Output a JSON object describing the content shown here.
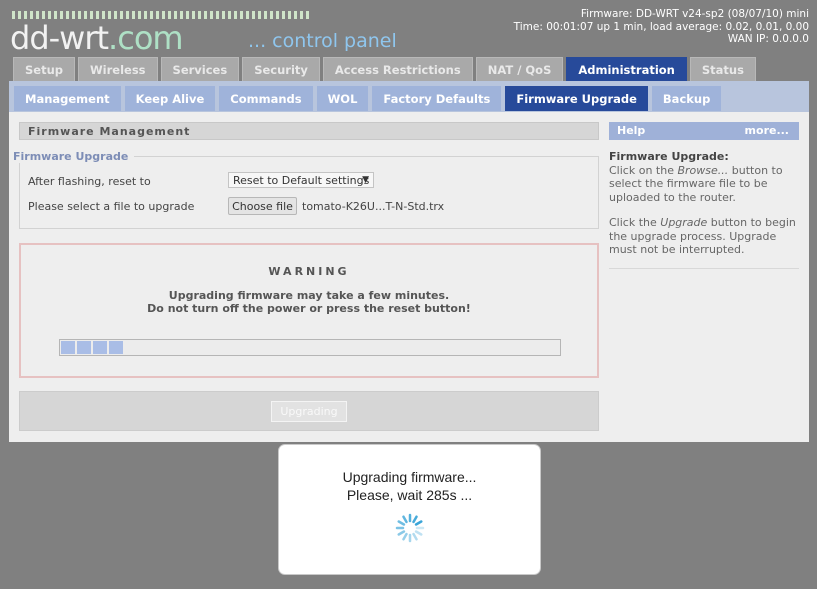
{
  "header": {
    "logo_main": "dd-wrt",
    "logo_domain": ".com",
    "tagline": "... control panel",
    "firmware": "Firmware: DD-WRT v24-sp2 (08/07/10) mini",
    "time": "Time: 00:01:07 up 1 min, load average: 0.02, 0.01, 0.00",
    "wan_ip": "WAN IP: 0.0.0.0"
  },
  "main_tabs": [
    "Setup",
    "Wireless",
    "Services",
    "Security",
    "Access Restrictions",
    "NAT / QoS",
    "Administration",
    "Status"
  ],
  "main_tab_active": "Administration",
  "sub_tabs": [
    "Management",
    "Keep Alive",
    "Commands",
    "WOL",
    "Factory Defaults",
    "Firmware Upgrade",
    "Backup"
  ],
  "sub_tab_active": "Firmware Upgrade",
  "section": {
    "title": "Firmware Management",
    "legend": "Firmware Upgrade",
    "reset_label": "After flashing, reset to",
    "reset_value": "Reset to Default settings",
    "file_label": "Please select a file to upgrade",
    "file_button": "Choose file",
    "file_name": "tomato-K26U...T-N-Std.trx"
  },
  "warning": {
    "title": "WARNING",
    "line1": "Upgrading firmware may take a few minutes.",
    "line2": "Do not turn off the power or press the reset button!",
    "progress_segments": 4
  },
  "upgrade_button": "Upgrading",
  "help": {
    "title": "Help",
    "more": "more...",
    "heading": "Firmware Upgrade:",
    "p1_a": "Click on the ",
    "p1_em": "Browse...",
    "p1_b": " button to select the firmware file to be uploaded to the router.",
    "p2_a": "Click the ",
    "p2_em": "Upgrade",
    "p2_b": " button to begin the upgrade process. Upgrade must not be interrupted."
  },
  "modal": {
    "line1": "Upgrading firmware...",
    "line2": "Please, wait 285s ..."
  },
  "colors": {
    "active_tab": "#274a9a",
    "sub_tab": "#9fb3da",
    "progress": "#a9bde6",
    "spinner": "#3aa5d8"
  }
}
